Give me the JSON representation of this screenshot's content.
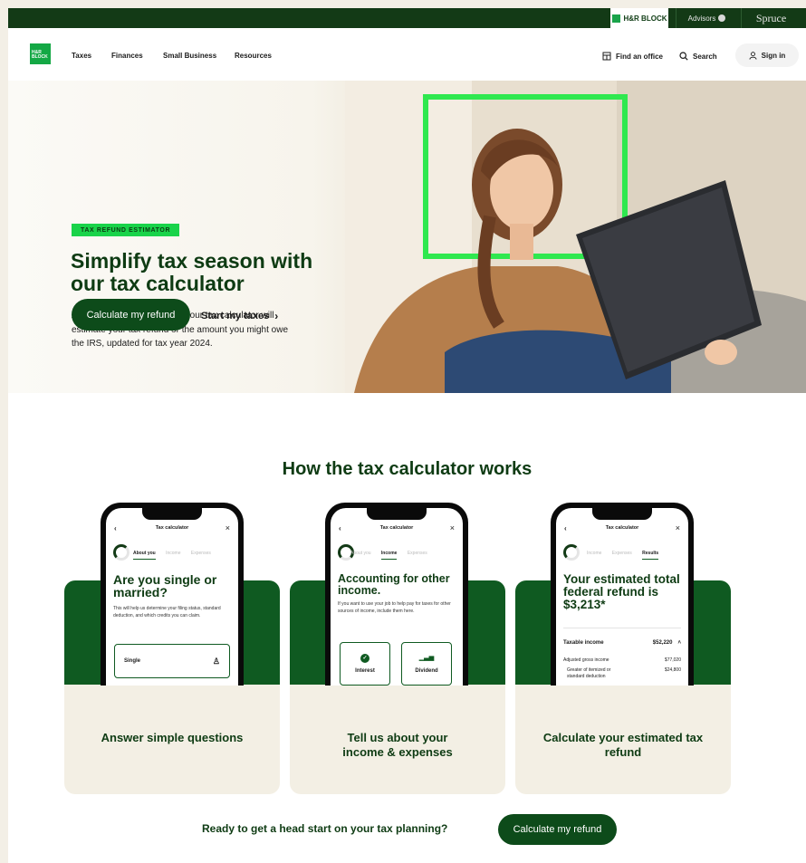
{
  "topbar": {
    "brands": [
      "H&R BLOCK",
      "Advisors",
      "Spruce"
    ]
  },
  "nav": {
    "logo": "H&R BLOCK",
    "links": [
      "Taxes",
      "Finances",
      "Small Business",
      "Resources"
    ],
    "find_office": "Find an office",
    "search": "Search",
    "sign_in": "Sign in"
  },
  "hero": {
    "badge": "TAX REFUND ESTIMATOR",
    "title": "Simplify tax season with our tax calculator",
    "description": "Answer a few questions, and our tax calculator will estimate your tax refund or the amount you might owe the IRS, updated for tax year 2024.",
    "primary_button": "Calculate my refund",
    "secondary_link": "Start my taxes"
  },
  "how": {
    "heading": "How the tax calculator works",
    "cards": [
      {
        "label": "Answer simple questions",
        "phone": {
          "header": "Tax calculator",
          "tabs": [
            "About you",
            "Income",
            "Expenses"
          ],
          "active_tab": 0,
          "title": "Are you single or married?",
          "body": "This will help us determine your filing status, standard deduction, and which credits you can claim.",
          "option": "Single"
        }
      },
      {
        "label": "Tell us about your income & expenses",
        "phone": {
          "header": "Tax calculator",
          "tabs": [
            "About you",
            "Income",
            "Expenses"
          ],
          "active_tab": 1,
          "title": "Accounting for other income.",
          "body": "If you want to use your job to help pay for taxes for other sources of income, include them here.",
          "options": [
            "Interest",
            "Dividend"
          ]
        }
      },
      {
        "label": "Calculate your estimated tax refund",
        "phone": {
          "header": "Tax calculator",
          "tabs": [
            "Income",
            "Expenses",
            "Results"
          ],
          "active_tab": 2,
          "title": "Your estimated total federal refund is $3,213*",
          "rows": [
            {
              "label": "Taxable income",
              "value": "$52,220"
            },
            {
              "label": "Adjusted gross income",
              "value": "$77,020"
            },
            {
              "label": "Greater of itemized or standard deduction",
              "value": "$24,800"
            }
          ]
        }
      }
    ]
  },
  "cta": {
    "text": "Ready to get a head start on your tax planning?",
    "button": "Calculate my refund"
  }
}
